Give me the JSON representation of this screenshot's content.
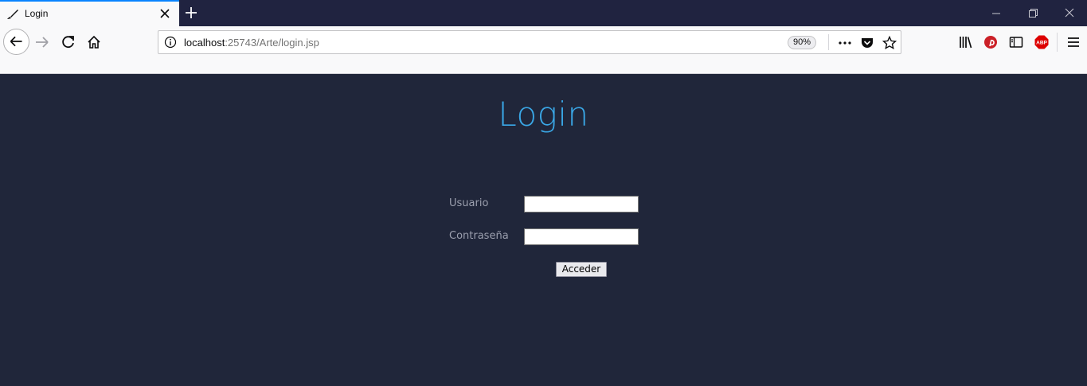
{
  "browser": {
    "tab": {
      "title": "Login",
      "favicon": "brush-icon"
    },
    "window_controls": [
      "minimize-icon",
      "restore-icon",
      "close-icon"
    ],
    "url": {
      "host": "localhost",
      "rest": ":25743/Arte/login.jsp",
      "zoom": "90%"
    },
    "toolbar_icons": [
      "library-icon",
      "pinterest-icon",
      "sidebar-icon",
      "adblock-icon",
      "hamburger-menu-icon"
    ]
  },
  "page": {
    "title": "Login",
    "form": {
      "user_label": "Usuario",
      "user_value": "",
      "pass_label": "Contraseña",
      "pass_value": "",
      "submit_label": "Acceder"
    }
  },
  "colors": {
    "page_background": "#20263a",
    "title": "#3aa7e6",
    "label": "#9b9fae",
    "tab_accent": "#0a84ff"
  }
}
